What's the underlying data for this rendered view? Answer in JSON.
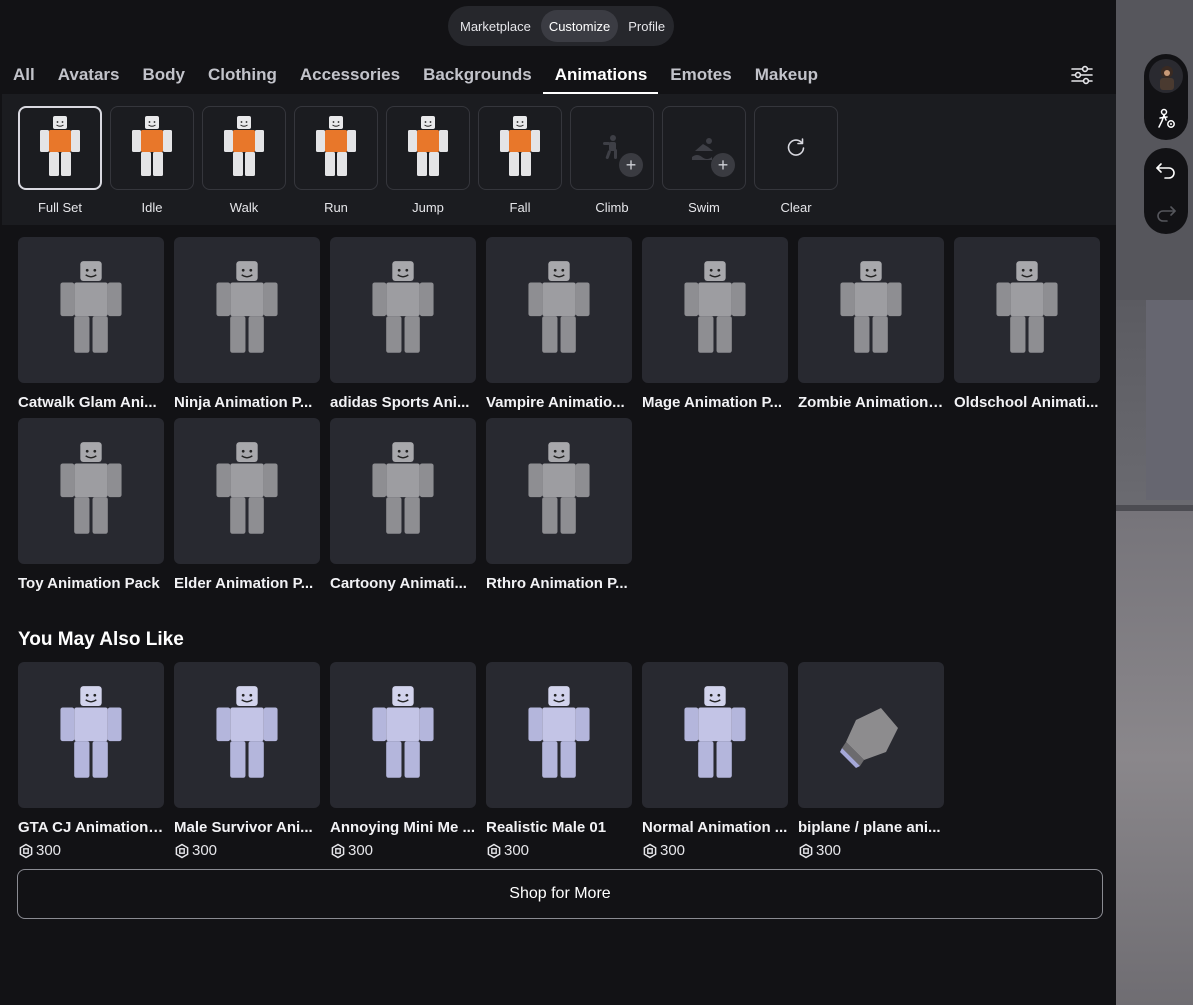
{
  "topnav": {
    "tabs": [
      {
        "label": "Marketplace",
        "active": false
      },
      {
        "label": "Customize",
        "active": true
      },
      {
        "label": "Profile",
        "active": false
      }
    ]
  },
  "categories": [
    {
      "label": "All",
      "active": false
    },
    {
      "label": "Avatars",
      "active": false
    },
    {
      "label": "Body",
      "active": false
    },
    {
      "label": "Clothing",
      "active": false
    },
    {
      "label": "Accessories",
      "active": false
    },
    {
      "label": "Backgrounds",
      "active": false
    },
    {
      "label": "Animations",
      "active": true
    },
    {
      "label": "Emotes",
      "active": false
    },
    {
      "label": "Makeup",
      "active": false
    }
  ],
  "slots": [
    {
      "label": "Full Set",
      "selected": true,
      "icon": "avatar-pose-icon"
    },
    {
      "label": "Idle",
      "selected": false,
      "icon": "avatar-pose-icon"
    },
    {
      "label": "Walk",
      "selected": false,
      "icon": "avatar-pose-icon"
    },
    {
      "label": "Run",
      "selected": false,
      "icon": "avatar-pose-icon"
    },
    {
      "label": "Jump",
      "selected": false,
      "icon": "avatar-pose-icon"
    },
    {
      "label": "Fall",
      "selected": false,
      "icon": "avatar-pose-icon"
    },
    {
      "label": "Climb",
      "selected": false,
      "icon": "climb-icon"
    },
    {
      "label": "Swim",
      "selected": false,
      "icon": "swim-icon"
    },
    {
      "label": "Clear",
      "selected": false,
      "icon": "reset-icon"
    }
  ],
  "items": [
    {
      "name": "Catwalk Glam Ani..."
    },
    {
      "name": "Ninja Animation P..."
    },
    {
      "name": "adidas Sports Ani..."
    },
    {
      "name": "Vampire Animatio..."
    },
    {
      "name": "Mage Animation P..."
    },
    {
      "name": "Zombie Animation ..."
    },
    {
      "name": "Oldschool Animati..."
    },
    {
      "name": "Toy Animation Pack"
    },
    {
      "name": "Elder Animation P..."
    },
    {
      "name": "Cartoony Animati..."
    },
    {
      "name": "Rthro Animation P..."
    }
  ],
  "recommendations": {
    "title": "You May Also Like",
    "currency_icon": "robux-icon",
    "items": [
      {
        "name": "GTA CJ Animation ...",
        "price": "300"
      },
      {
        "name": "Male Survivor Ani...",
        "price": "300"
      },
      {
        "name": "Annoying Mini Me ...",
        "price": "300"
      },
      {
        "name": "Realistic Male 01",
        "price": "300"
      },
      {
        "name": "Normal Animation ...",
        "price": "300"
      },
      {
        "name": "biplane / plane ani...",
        "price": "300"
      }
    ]
  },
  "shop_button": {
    "label": "Shop for More"
  },
  "colors": {
    "background": "#121215",
    "card": "#282930",
    "accent_orange": "#e8772a"
  },
  "viewport_tools": [
    "avatar-thumbnail",
    "avatar-settings-icon",
    "undo-icon",
    "redo-icon"
  ]
}
